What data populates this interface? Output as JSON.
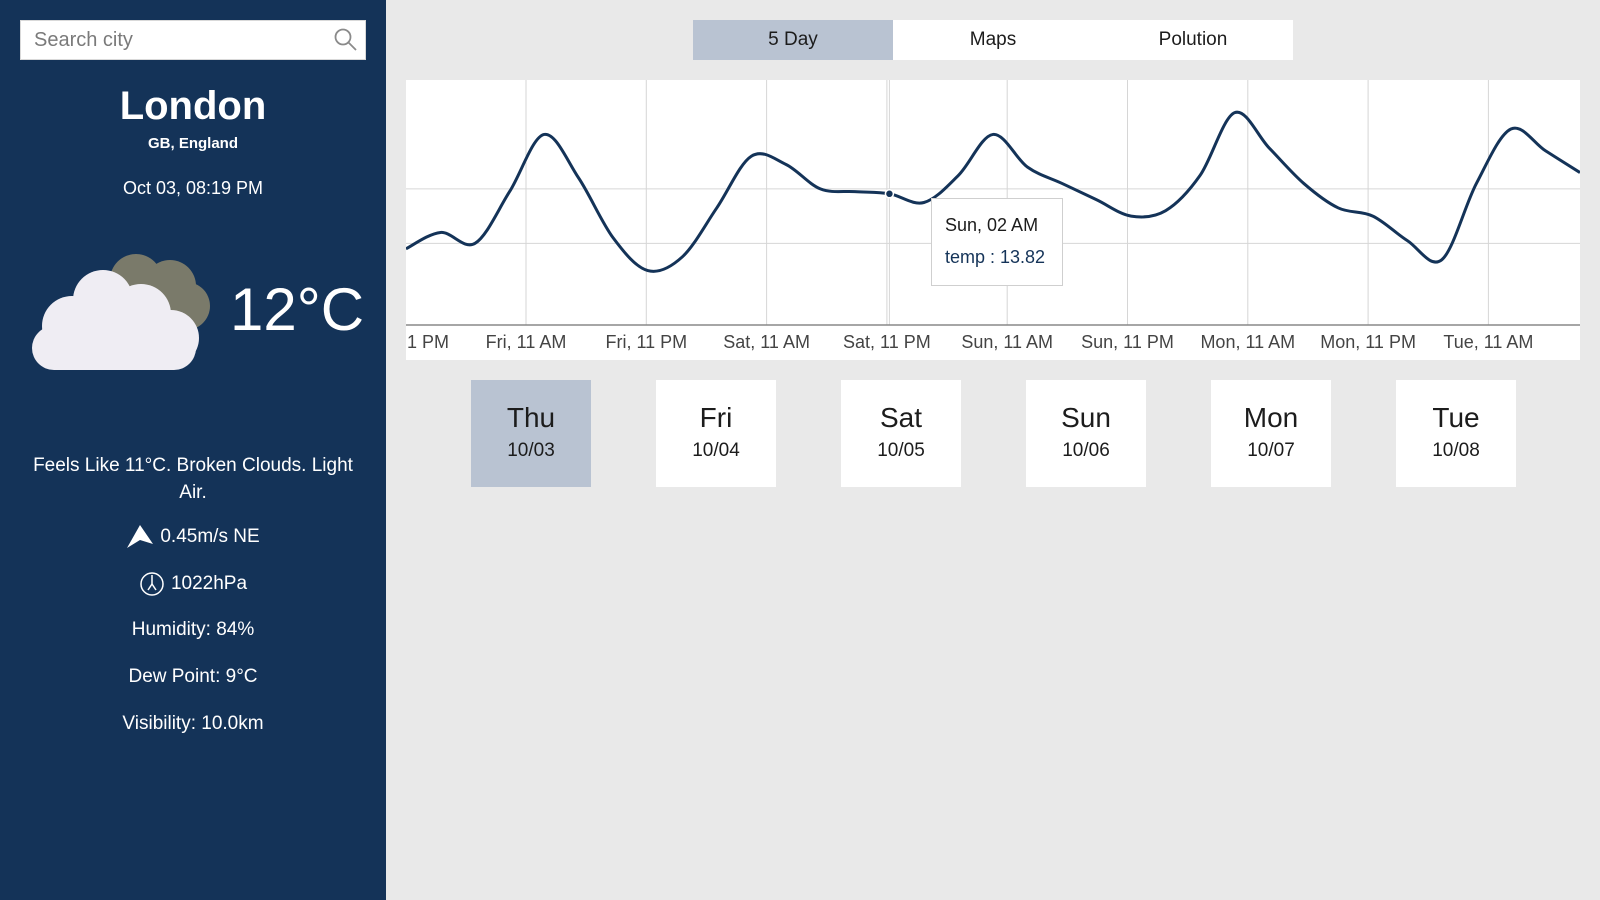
{
  "search": {
    "placeholder": "Search city"
  },
  "location": {
    "city": "London",
    "region": "GB, England"
  },
  "current": {
    "datetime": "Oct 03, 08:19 PM",
    "icon": "cloud-icon",
    "temperature": "12°C",
    "summary": "Feels Like 11°C.  Broken Clouds. Light Air.",
    "wind": "0.45m/s NE",
    "pressure": "1022hPa",
    "humidity": "Humidity: 84%",
    "dew_point": "Dew Point: 9°C",
    "visibility": "Visibility: 10.0km"
  },
  "tabs": [
    {
      "label": "5 Day",
      "active": true
    },
    {
      "label": "Maps",
      "active": false
    },
    {
      "label": "Polution",
      "active": false
    }
  ],
  "chart_data": {
    "type": "line",
    "series": [
      {
        "values": [
          11.8,
          12.4,
          12.0,
          13.9,
          16.0,
          14.4,
          12.2,
          11.0,
          11.5,
          13.3,
          15.2,
          14.9,
          14.0,
          13.9,
          13.82,
          13.5,
          14.5,
          16.0,
          14.8,
          14.2,
          13.6,
          13.0,
          13.2,
          14.5,
          16.8,
          15.5,
          14.2,
          13.3,
          13.0,
          12.1,
          11.4,
          14.2,
          16.2,
          15.4,
          14.6
        ]
      }
    ],
    "x_tick_labels": [
      "1 PM",
      "Fri, 11 AM",
      "Fri, 11 PM",
      "Sat, 11 AM",
      "Sat, 11 PM",
      "Sun, 11 AM",
      "Sun, 11 PM",
      "Mon, 11 AM",
      "Mon, 11 PM",
      "Tue, 11 AM"
    ],
    "tooltip": {
      "title": "Sun, 02 AM",
      "text": "temp : 13.82"
    },
    "grid": true,
    "line_color": "#143358"
  },
  "days": [
    {
      "name": "Thu",
      "date": "10/03",
      "active": true
    },
    {
      "name": "Fri",
      "date": "10/04",
      "active": false
    },
    {
      "name": "Sat",
      "date": "10/05",
      "active": false
    },
    {
      "name": "Sun",
      "date": "10/06",
      "active": false
    },
    {
      "name": "Mon",
      "date": "10/07",
      "active": false
    },
    {
      "name": "Tue",
      "date": "10/08",
      "active": false
    }
  ]
}
